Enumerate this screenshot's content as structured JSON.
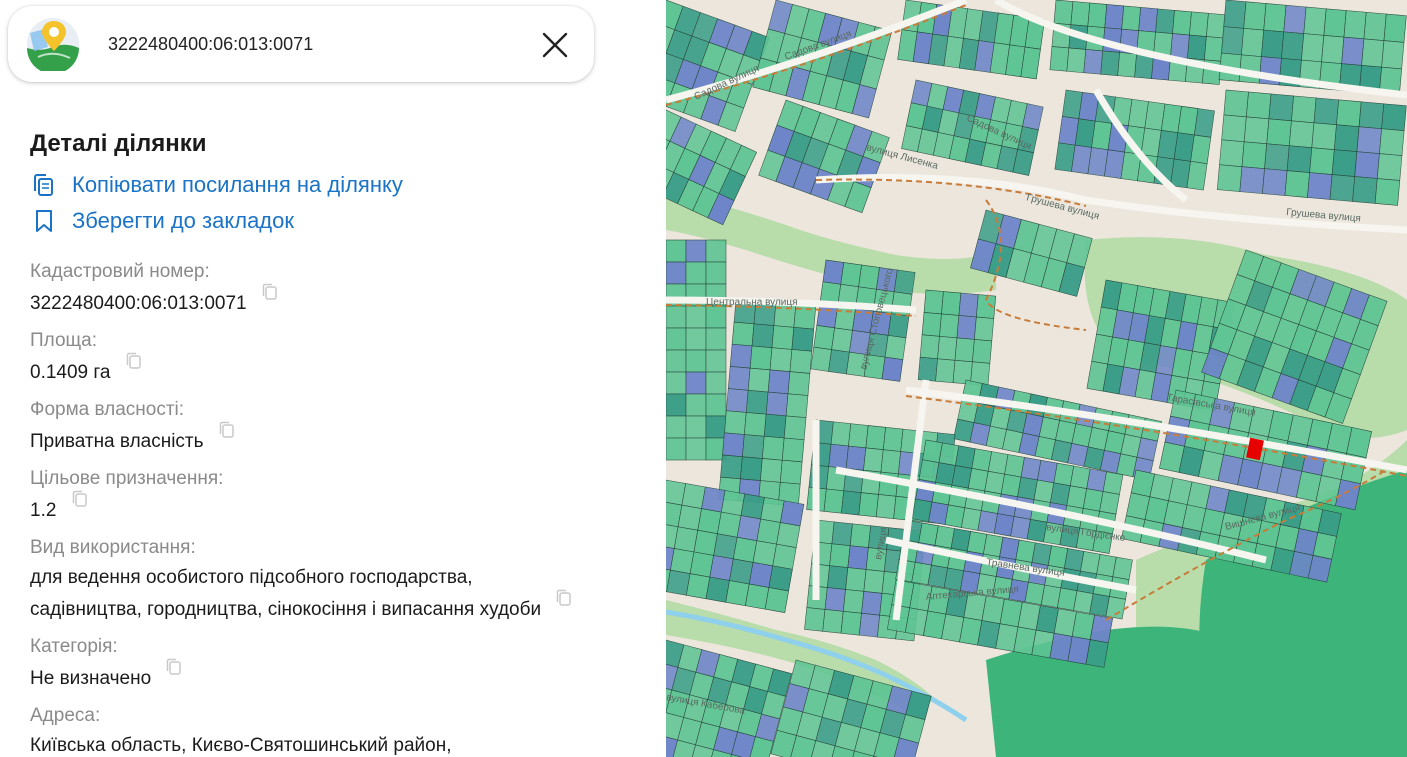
{
  "search": {
    "value": "3222480400:06:013:0071",
    "logo_icon": "map-pin-globe-icon",
    "close_icon": "close-icon"
  },
  "details": {
    "title": "Деталі ділянки",
    "copy_link_label": "Копіювати посилання на ділянку",
    "bookmark_label": "Зберегти до закладок"
  },
  "fields": {
    "cadastral_label": "Кадастровий номер:",
    "cadastral_value": "3222480400:06:013:0071",
    "area_label": "Площа:",
    "area_value": "0.1409 га",
    "ownership_label": "Форма власності:",
    "ownership_value": "Приватна власність",
    "purpose_label": "Цільове призначення:",
    "purpose_value": "1.2",
    "usage_label": "Вид використання:",
    "usage_value_line1": "для ведення особистого підсобного господарства,",
    "usage_value_line2": "садівництва, городництва, сінокосіння і випасання худоби",
    "category_label": "Категорія:",
    "category_value": "Не визначено",
    "address_label": "Адреса:",
    "address_value": "Київська область, Києво-Святошинський район,"
  },
  "map": {
    "street_labels": [
      "Садова вулиця",
      "Садова вулиця",
      "вулиця Лисенка",
      "Садова вулиця",
      "Грушева вулиця",
      "Грушева вулиця",
      "Центральна вулиця",
      "Тарасівська вулиця",
      "вулиця Гордієнко",
      "Травнева вулиця",
      "Аптекарська вулиця",
      "вулиця Каберова",
      "вулиця Стоповецького",
      "вулиця",
      "Вишнева вулиця"
    ],
    "colors": {
      "background": "#ece6dd",
      "parcel_green": "#5fc594",
      "parcel_blue": "#6e86c9",
      "parcel_teal": "#3a9e88",
      "forest": "#3db57a",
      "park": "#b8dcaa",
      "selected_parcel": "#e60000",
      "road": "#f7f5f0",
      "path": "#c87c3a",
      "water": "#8fd0ec"
    }
  }
}
